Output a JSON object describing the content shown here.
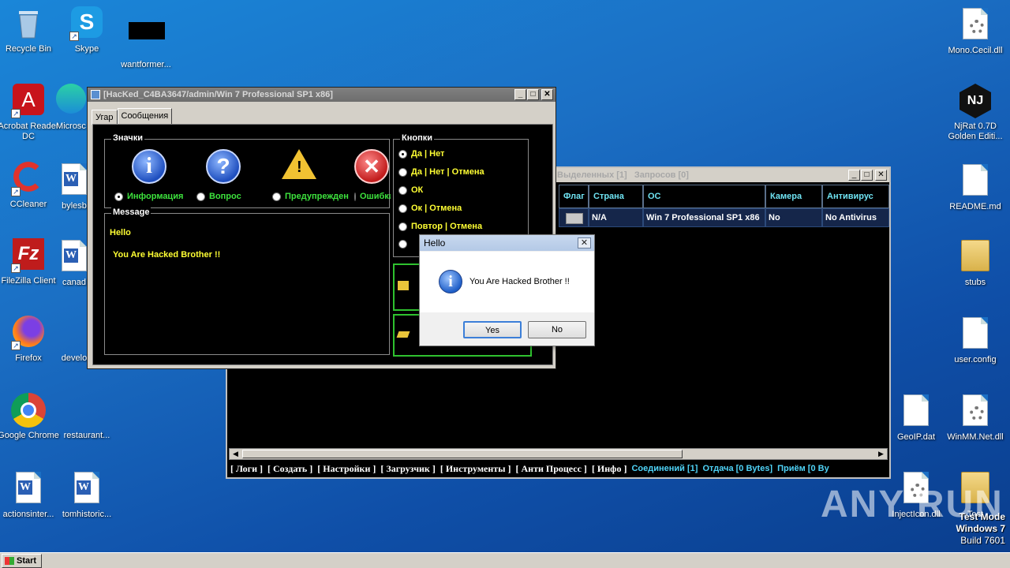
{
  "desktop_icons": {
    "recycle_bin": "Recycle Bin",
    "skype": "Skype",
    "wantformer": "wantformer...",
    "acrobat": "Acrobat Reader DC",
    "microsoft": "Microsc",
    "ccleaner": "CCleaner",
    "bylesb": "bylesb",
    "filezilla": "FileZilla Client",
    "canada": "canad",
    "firefox": "Firefox",
    "develo": "develo",
    "chrome": "Google Chrome",
    "restaurant": "restaurant...",
    "actionsinter": "actionsinter...",
    "tomhistoric": "tomhistoric...",
    "mono_cecil": "Mono.Cecil.dll",
    "njrat": "NjRat 0.7D Golden Editi...",
    "readme": "README.md",
    "stubs": "stubs",
    "user_config": "user.config",
    "geoip": "GeoIP.dat",
    "winmm": "WinMM.Net.dll",
    "injecticon": "InjectIcon.dll",
    "test": "Test"
  },
  "main_window": {
    "title_selected": "Выделенных [1]",
    "title_requests": "Запросов [0]",
    "columns": [
      "Флаг",
      "Страна",
      "ОС",
      "Камера",
      "Антивирус"
    ],
    "row": [
      "N/A",
      "Win 7 Professional SP1 x86",
      "No",
      "No Antivirus"
    ],
    "menu": [
      "[ Логи ]",
      "[ Создать ]",
      "[ Настройки ]",
      "[ Загрузчик ]",
      "[ Инструменты ]",
      "[ Анти Процесс ]",
      "[ Инфо ]"
    ],
    "status": [
      "Соединений [1]",
      "Отдача [0 Bytes]",
      "Приём [0 By"
    ]
  },
  "msg_window": {
    "title": "[HacKed_C4BA3647/admin/Win 7 Professional SP1 x86]",
    "tabs": [
      "Угар",
      "Сообщения"
    ],
    "icons_group": "Значки",
    "icon_options": [
      "Информация",
      "Вопрос",
      "Предупрежден",
      "Ошибка"
    ],
    "buttons_group": "Кнопки",
    "button_options": [
      "Да | Нет",
      "Да | Нет | Отмена",
      "ОК",
      "Ок | Отмена",
      "Повтор | Отмена"
    ],
    "message_group": "Message",
    "msg_title": "Hello",
    "msg_text": "You Are Hacked Brother !!"
  },
  "dialog": {
    "title": "Hello",
    "text": "You Are Hacked Brother !!",
    "yes": "Yes",
    "no": "No",
    "close": "✕"
  },
  "taskbar": {
    "start": "Start"
  },
  "watermark": "ANY RUN",
  "test_mode": {
    "line1": "Test Mode",
    "line2": "Windows 7",
    "line3": "Build 7601"
  }
}
